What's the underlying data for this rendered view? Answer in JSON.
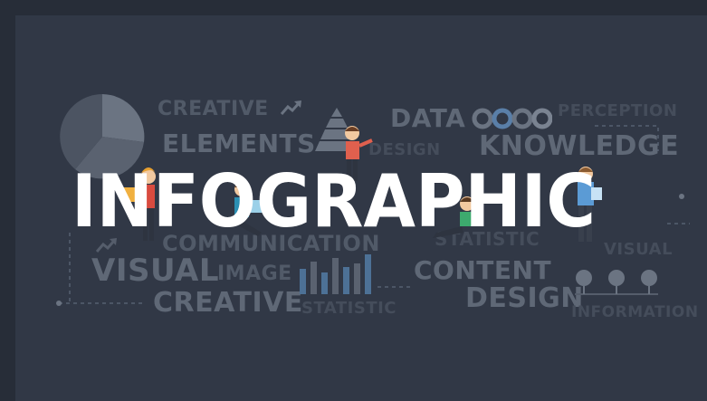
{
  "headline": "INFOGRAPHIC",
  "words": {
    "creative_top": "CREATIVE",
    "elements": "ELEMENTS",
    "data": "DATA",
    "perception": "PERCEPTION",
    "design_small": "DESIGN",
    "knowledge": "KNOWLEDGE",
    "communication": "COMMUNICATION",
    "statistic_mid": "STATISTIC",
    "visual_left": "VISUAL",
    "image": "IMAGE",
    "content": "CONTENT",
    "visual_right": "VISUAL",
    "creative_bottom": "CREATIVE",
    "statistic_bottom": "STATISTIC",
    "design_bottom": "DESIGN",
    "information": "INFORMATION"
  },
  "colors": {
    "background": "#313846",
    "headline": "#ffffff",
    "muted_text": "#5f6876"
  },
  "icons": [
    "pie-chart-icon",
    "pyramid-icon",
    "trend-arrow-icon",
    "circle-progress-icon",
    "bar-chart-icon",
    "node-pins-icon",
    "person-illustration"
  ]
}
